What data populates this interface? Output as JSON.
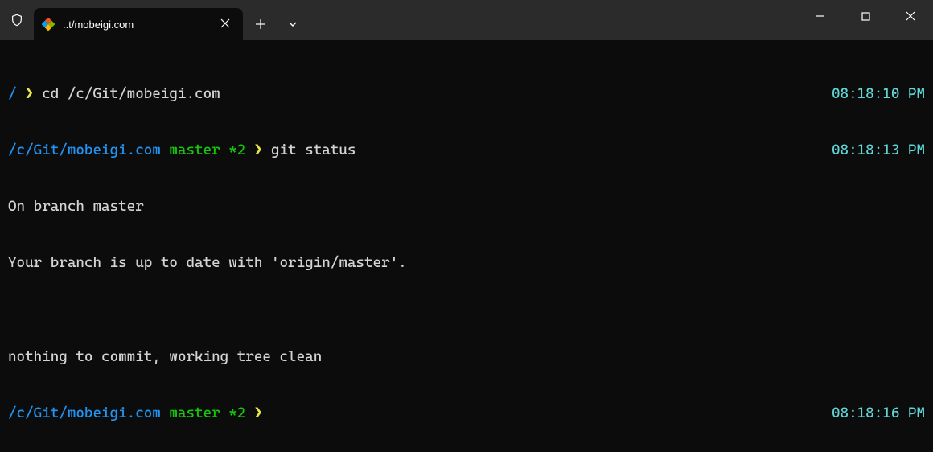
{
  "titlebar": {
    "tab_title": "..t/mobeigi.com"
  },
  "lines": {
    "l1_path": "/ ",
    "l1_arrow": "❯ ",
    "l1_cmd": "cd /c/Git/mobeigi.com",
    "l1_time": "08:18:10 PM",
    "l2_path": "/c/Git/mobeigi.com ",
    "l2_branch": "master *2 ",
    "l2_arrow": "❯ ",
    "l2_cmd": "git status",
    "l2_time": "08:18:13 PM",
    "l3": "On branch master",
    "l4": "Your branch is up to date with 'origin/master'.",
    "l5": "",
    "l6": "nothing to commit, working tree clean",
    "l7_path": "/c/Git/mobeigi.com ",
    "l7_branch": "master *2 ",
    "l7_arrow": "❯ ",
    "l7_time": "08:18:16 PM"
  }
}
